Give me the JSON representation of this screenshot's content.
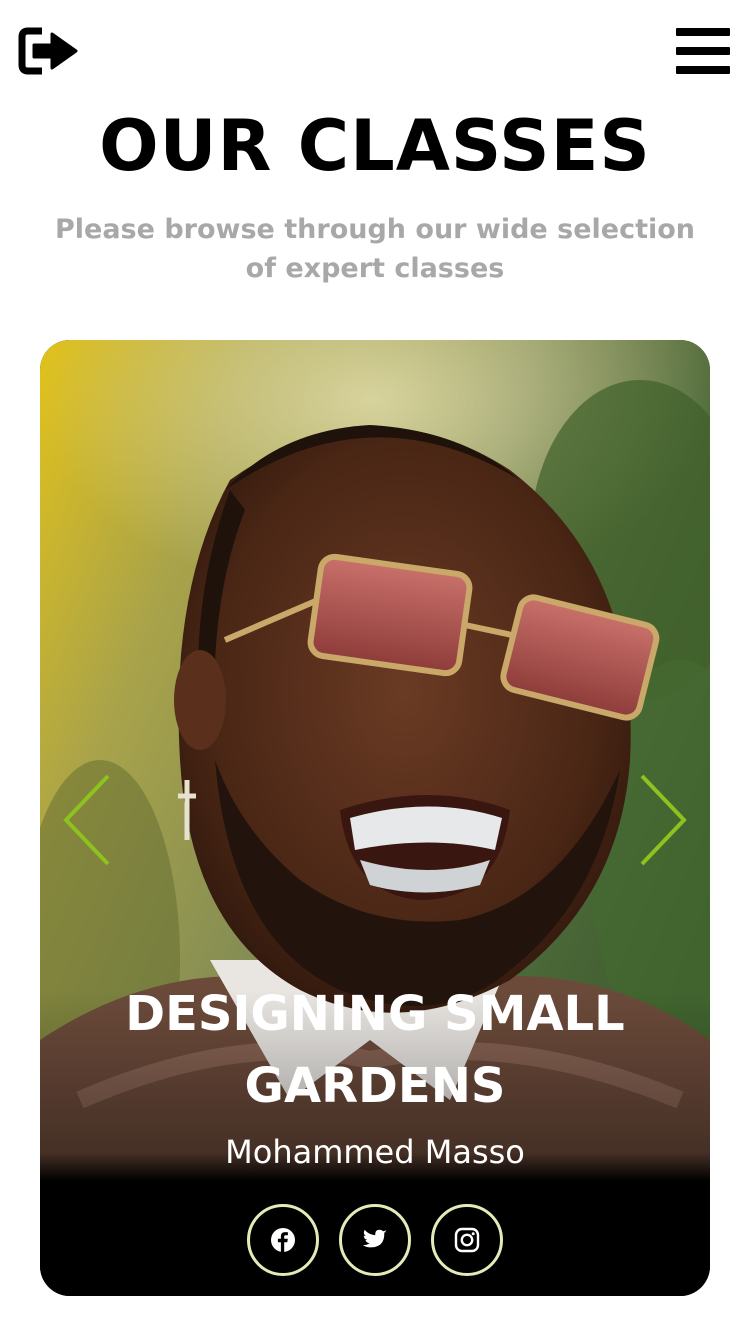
{
  "header": {
    "logout_icon": "logout-arrow-icon",
    "menu_icon": "hamburger-menu-icon"
  },
  "page": {
    "title": "OUR CLASSES",
    "subtitle": "Please browse through our wide selection of expert classes"
  },
  "carousel": {
    "accent_color": "#8dc21f",
    "slide": {
      "photo": "man-with-tinted-glasses-photo",
      "title": "DESIGNING SMALL GARDENS",
      "instructor": "Mohammed Masso"
    },
    "social": [
      {
        "name": "facebook",
        "icon": "facebook-icon"
      },
      {
        "name": "twitter",
        "icon": "twitter-icon"
      },
      {
        "name": "instagram",
        "icon": "instagram-icon"
      }
    ]
  }
}
